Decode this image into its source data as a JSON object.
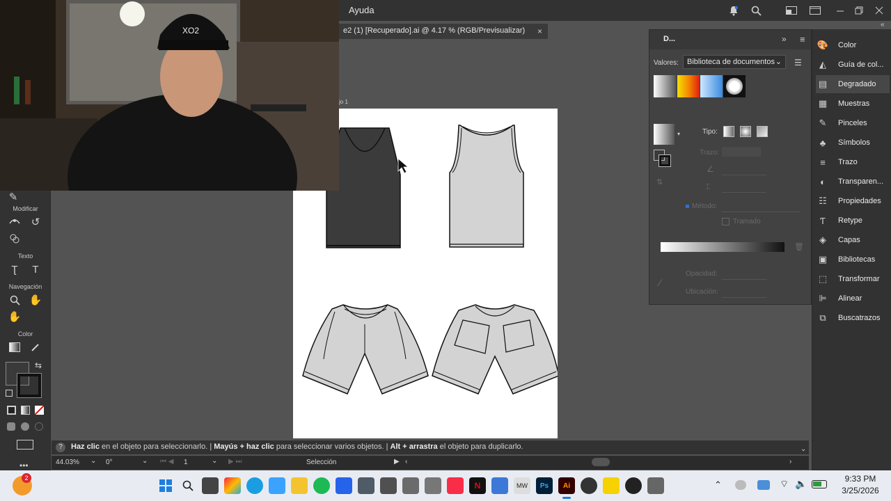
{
  "menu": {
    "help": "Ayuda"
  },
  "document_tab": {
    "title": "e2  (1) [Recuperado].ai @ 4.17 % (RGB/Previsualizar)",
    "close": "×"
  },
  "artboard": {
    "label": "jo 1"
  },
  "toolbar": {
    "sections": {
      "modify": "Modificar",
      "text": "Texto",
      "navigation": "Navegación",
      "color": "Color"
    }
  },
  "status": {
    "hint_1_bold": "Haz clic",
    "hint_1": " en el objeto para seleccionarlo.  |  ",
    "hint_2_bold": "Mayús + haz clic",
    "hint_2": " para seleccionar varios objetos.  |  ",
    "hint_3_bold": "Alt + arrastra",
    "hint_3": " el objeto para duplicarlo.",
    "zoom": "44.03%",
    "rotation": "0°",
    "artboard_num": "1",
    "tool": "Selección"
  },
  "gradient_panel": {
    "tab": "D...",
    "values_label": "Valores:",
    "library": "Biblioteca de documentos",
    "type_label": "Tipo:",
    "stroke_label": "Trazo:",
    "method_label": "Método:",
    "dither_label": "Tramado",
    "opacity_label": "Opacidad:",
    "location_label": "Ubicación:"
  },
  "dock": {
    "items": [
      {
        "label": "Color",
        "icon": "palette-icon"
      },
      {
        "label": "Guía de col...",
        "icon": "color-guide-icon"
      },
      {
        "label": "Degradado",
        "icon": "gradient-icon",
        "active": true
      },
      {
        "label": "Muestras",
        "icon": "swatches-icon"
      },
      {
        "label": "Pinceles",
        "icon": "brush-icon"
      },
      {
        "label": "Símbolos",
        "icon": "symbols-icon"
      },
      {
        "label": "Trazo",
        "icon": "stroke-icon"
      },
      {
        "label": "Transparen...",
        "icon": "transparency-icon"
      },
      {
        "label": "Propiedades",
        "icon": "properties-icon"
      },
      {
        "label": "Retype",
        "icon": "retype-icon"
      },
      {
        "label": "Capas",
        "icon": "layers-icon"
      },
      {
        "label": "Bibliotecas",
        "icon": "libraries-icon"
      },
      {
        "label": "Transformar",
        "icon": "transform-icon"
      },
      {
        "label": "Alinear",
        "icon": "align-icon"
      },
      {
        "label": "Buscatrazos",
        "icon": "pathfinder-icon"
      }
    ]
  },
  "taskbar": {
    "notification_badge": "2",
    "time": "9:33 PM",
    "date": "3/25/2026",
    "ai_label": "Ai",
    "ps_label": "Ps"
  },
  "colors": {
    "garment_fill": "#d3d3d3",
    "tank_dark": "#3b3b3b",
    "accent": "#2f6fd8"
  }
}
